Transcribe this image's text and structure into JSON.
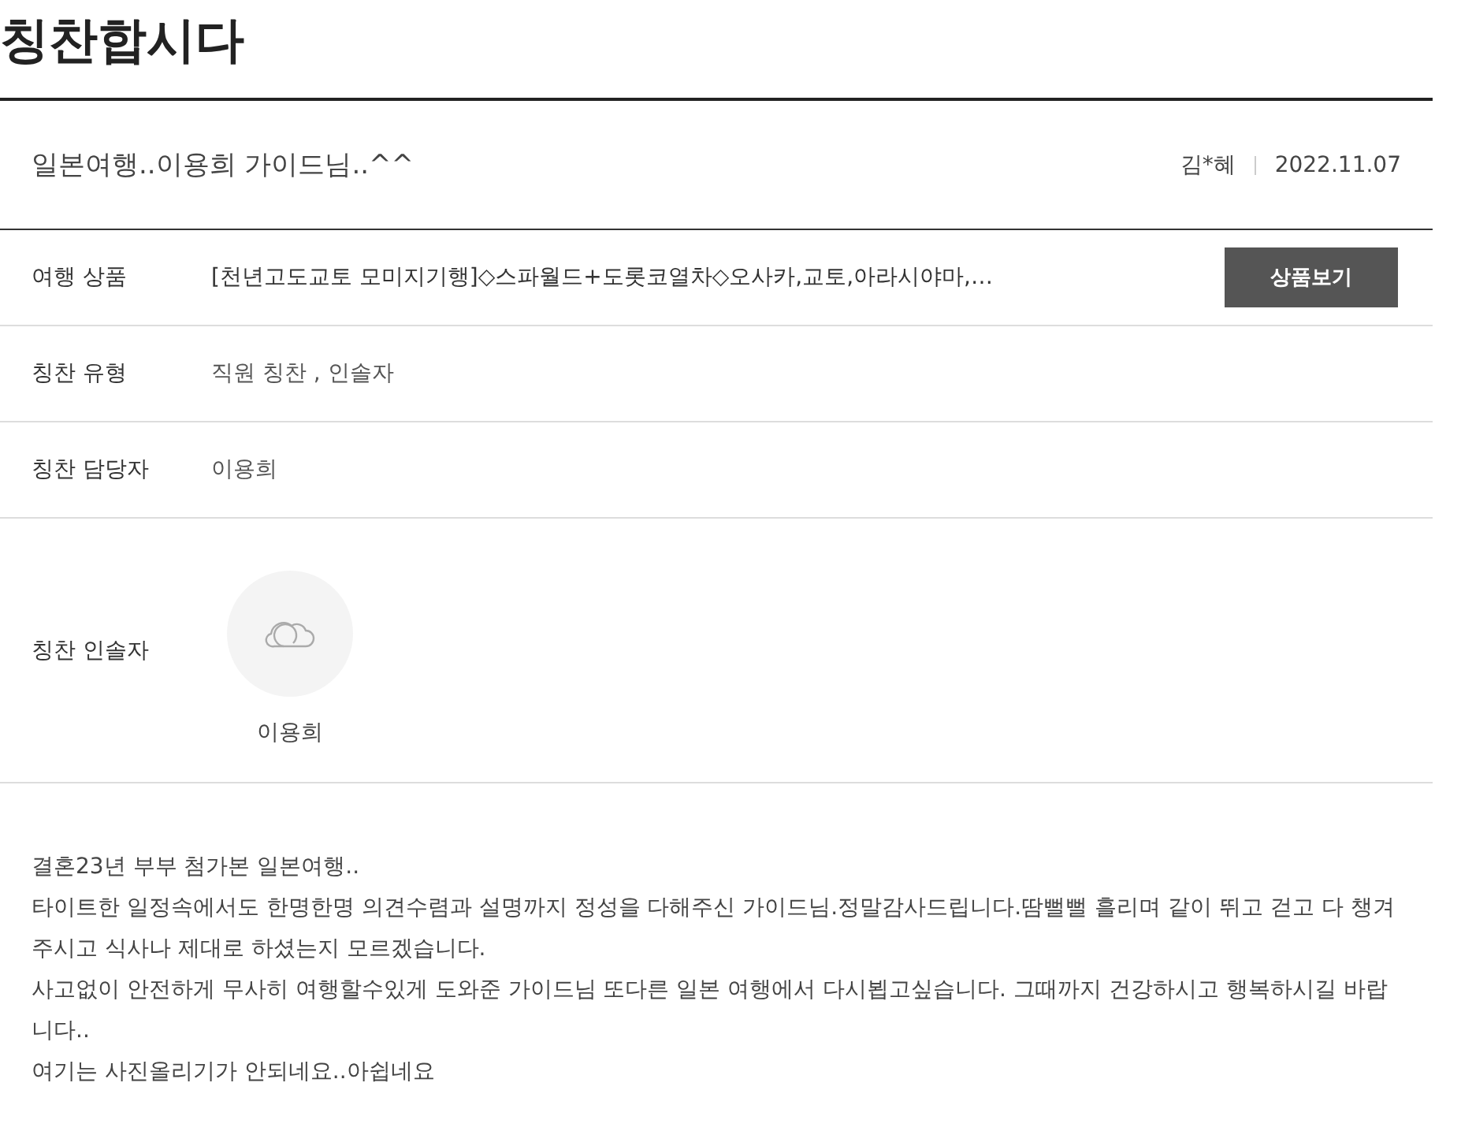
{
  "page_title": "칭찬합시다",
  "post": {
    "title": "일본여행..이용희 가이드님..^^",
    "author": "김*혜",
    "date": "2022.11.07"
  },
  "fields": [
    {
      "kind": "product",
      "label": "여행 상품",
      "value": "[천년고도교토 모미지기행]◇스파월드+도롯코열차◇오사카,교토,아라시야마,…",
      "button": "상품보기"
    },
    {
      "kind": "text",
      "label": "칭찬 유형",
      "value": "직원 칭찬 , 인솔자"
    },
    {
      "kind": "text",
      "label": "칭찬 담당자",
      "value": "이용희"
    },
    {
      "kind": "person",
      "label": "칭찬 인솔자",
      "value": "이용희"
    }
  ],
  "body": [
    "결혼23년 부부 첨가본 일본여행..",
    "타이트한 일정속에서도 한명한명 의견수렴과 설명까지 정성을 다해주신 가이드님.정말감사드립니다.땀뻘뻘 흘리며 같이 뛰고 걷고 다 챙겨주시고 식사나 제대로 하셨는지 모르겠습니다.",
    "사고없이 안전하게 무사히 여행할수있게 도와준 가이드님 또다른 일본 여행에서 다시뵙고싶습니다. 그때까지 건강하시고 행복하시길 바랍니다..",
    "여기는 사진올리기가 안되네요..아쉽네요"
  ]
}
